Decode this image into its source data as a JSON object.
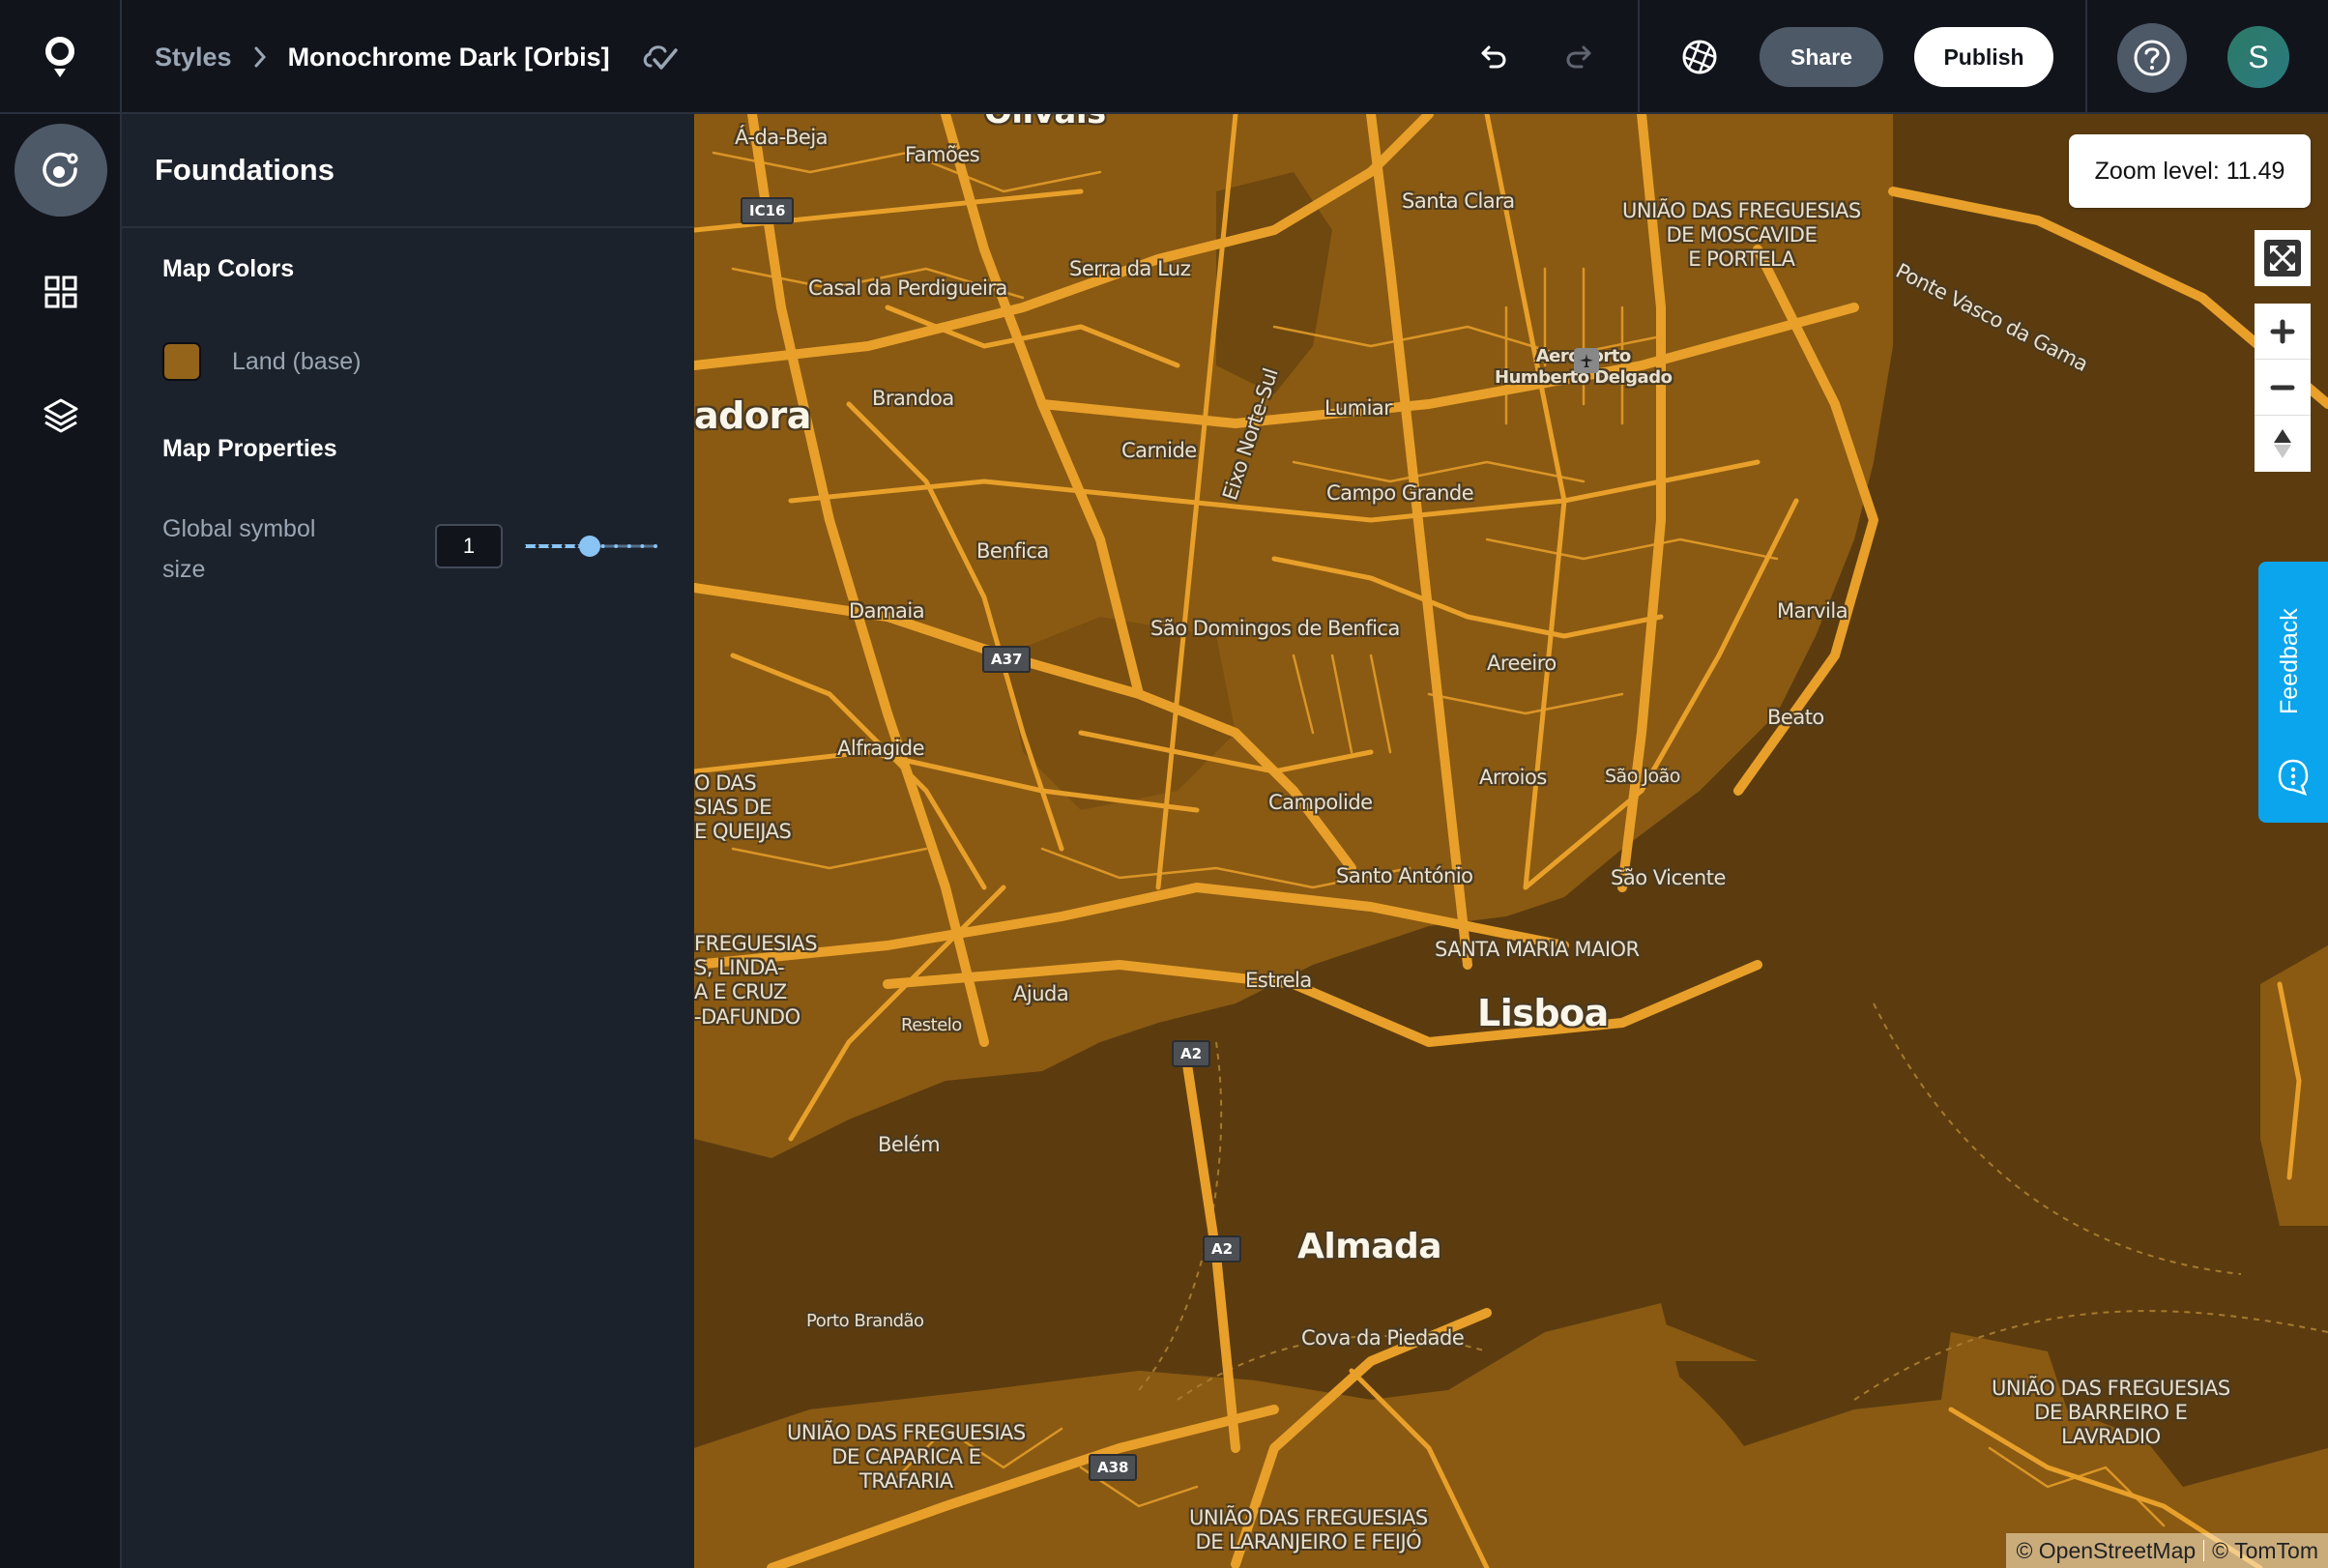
{
  "header": {
    "breadcrumb_root": "Styles",
    "breadcrumb_current": "Monochrome Dark [Orbis]",
    "saved_icon": "cloud-check-icon",
    "undo_icon": "undo-icon",
    "redo_icon": "redo-icon",
    "aperture_icon": "aperture-icon",
    "share_label": "Share",
    "publish_label": "Publish",
    "help_icon": "help-icon",
    "avatar_initial": "S"
  },
  "rail": {
    "items": [
      {
        "name": "foundations",
        "icon": "foundations-icon",
        "active": true
      },
      {
        "name": "components",
        "icon": "grid-icon",
        "active": false
      },
      {
        "name": "layers",
        "icon": "layers-icon",
        "active": false
      }
    ]
  },
  "panel": {
    "title": "Foundations",
    "map_colors_title": "Map Colors",
    "colors": [
      {
        "label": "Land (base)",
        "value": "#93641a"
      }
    ],
    "map_properties_title": "Map Properties",
    "global_symbol_size": {
      "label": "Global symbol size",
      "value": "1",
      "slider_fraction": 0.5
    }
  },
  "map": {
    "zoom_label": "Zoom level: 11.49",
    "land_color": "#8a5a12",
    "water_color": "#5c3c0f",
    "road_color": "#e8a02a",
    "controls": {
      "fullscreen_icon": "fullscreen-icon",
      "zoom_in_icon": "plus-icon",
      "zoom_out_icon": "minus-icon",
      "compass_icon": "compass-icon"
    },
    "feedback_label": "Feedback",
    "attribution": [
      "© OpenStreetMap",
      "© TomTom"
    ],
    "labels": {
      "olivais": "Olivais",
      "a_da_beja": "Á-da-Beja",
      "famoes": "Famões",
      "santa_clara": "Santa Clara",
      "moscavide": "UNIÃO DAS FREGUESIAS\nDE MOSCAVIDE\nE PORTELA",
      "ponte_vasco": "Ponte Vasco da Gama",
      "casal": "Casal da Perdigueira",
      "serra_luz": "Serra da Luz",
      "aeroporto": "Aeroporto\nHumberto Delgado",
      "eixo": "Eixo Norte-Sul",
      "lumiar": "Lumiar",
      "brandoa": "Brandoa",
      "amadora": "adora",
      "carnide": "Carnide",
      "campo_grande": "Campo Grande",
      "benfica": "Benfica",
      "marvila": "Marvila",
      "damaia": "Damaia",
      "sao_domingos": "São Domingos de Benfica",
      "areeiro": "Areeiro",
      "beato": "Beato",
      "alfragide": "Alfragide",
      "arroios": "Arroios",
      "sao_joao": "São João",
      "queijas": "O DAS\nSIAS DE\nE QUEIJAS",
      "campolide": "Campolide",
      "santo_antonio": "Santo António",
      "sao_vicente": "São Vicente",
      "linda": "FREGUESIAS\nS, LINDA-\nA E CRUZ\n-DAFUNDO",
      "santa_maria": "SANTA MARIA MAIOR",
      "estrela": "Estrela",
      "ajuda": "Ajuda",
      "lisboa": "Lisboa",
      "restelo": "Restelo",
      "belem": "Belém",
      "almada": "Almada",
      "porto_brandao": "Porto Brandão",
      "cova_piedade": "Cova da Piedade",
      "barreiro": "UNIÃO DAS FREGUESIAS\nDE BARREIRO E\nLAVRADIO",
      "caparica": "UNIÃO DAS FREGUESIAS\nDE CAPARICA E\nTRAFARIA",
      "laranjeiro": "UNIÃO DAS FREGUESIAS\nDE LARANJEIRO E FEIJÓ"
    },
    "shields": {
      "ic16": "IC16",
      "a37": "A37",
      "a2_north": "A2",
      "a2_south": "A2",
      "a38": "A38"
    }
  }
}
